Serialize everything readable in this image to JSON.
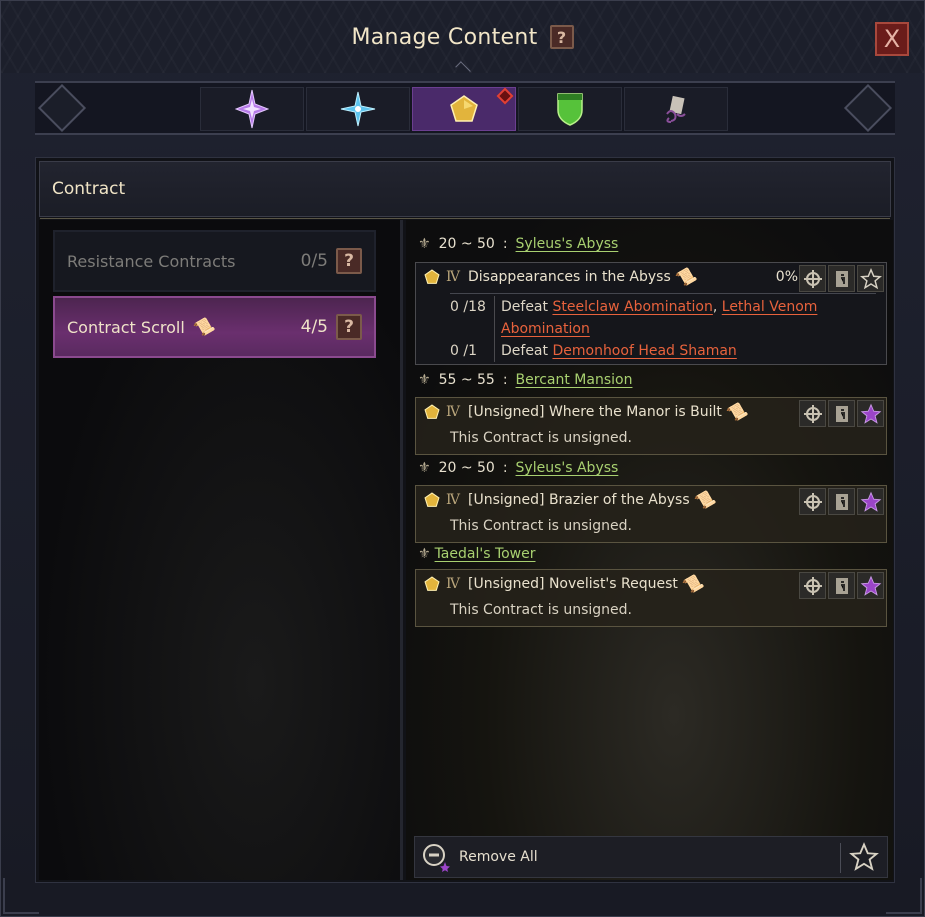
{
  "window": {
    "title": "Manage Content",
    "help": "?",
    "close": "X"
  },
  "tabs": [
    {
      "icon": "purple-star-icon",
      "active": false
    },
    {
      "icon": "blue-star-icon",
      "active": false
    },
    {
      "icon": "gold-pentagon-icon",
      "active": true,
      "badge": true
    },
    {
      "icon": "green-shield-icon",
      "active": false
    },
    {
      "icon": "scroll-creature-icon",
      "active": false
    }
  ],
  "section": {
    "title": "Contract"
  },
  "categories": [
    {
      "label": "Resistance Contracts",
      "count": "0/5",
      "help": "?"
    },
    {
      "label": "Contract Scroll",
      "count": "4/5",
      "help": "?"
    }
  ],
  "groups": [
    {
      "levels": "20 ~ 50",
      "zone": "Syleus's Abyss",
      "contract": {
        "rank": "Ⅳ",
        "title": "Disappearances in the Abyss",
        "percent": "0%",
        "objectives": [
          {
            "progress": "0 /18",
            "verb": "Defeat",
            "target1": "Steelclaw Abomination",
            "comma": ",",
            "target2": "Lethal Venom",
            "target3": "Abomination"
          },
          {
            "progress": "0 /1",
            "verb": "Defeat",
            "target1": "Demonhoof Head Shaman"
          }
        ]
      }
    },
    {
      "levels": "55 ~ 55",
      "zone": "Bercant Mansion",
      "contract": {
        "rank": "Ⅳ",
        "title": "[Unsigned] Where the Manor is Built",
        "note": "This Contract is unsigned."
      }
    },
    {
      "levels": "20 ~ 50",
      "zone": "Syleus's Abyss",
      "contract": {
        "rank": "Ⅳ",
        "title": "[Unsigned] Brazier of the Abyss",
        "note": "This Contract is unsigned."
      }
    },
    {
      "levels": "",
      "zone": "Taedal's Tower",
      "contract": {
        "rank": "Ⅳ",
        "title": "[Unsigned] Novelist's Request",
        "note": "This Contract is unsigned."
      }
    }
  ],
  "footer": {
    "remove_all": "Remove All"
  },
  "colors": {
    "accent_purple": "#6a2f6e",
    "zone_green": "#a8d070",
    "target_red": "#e8623c",
    "gold": "#e2b43c"
  }
}
